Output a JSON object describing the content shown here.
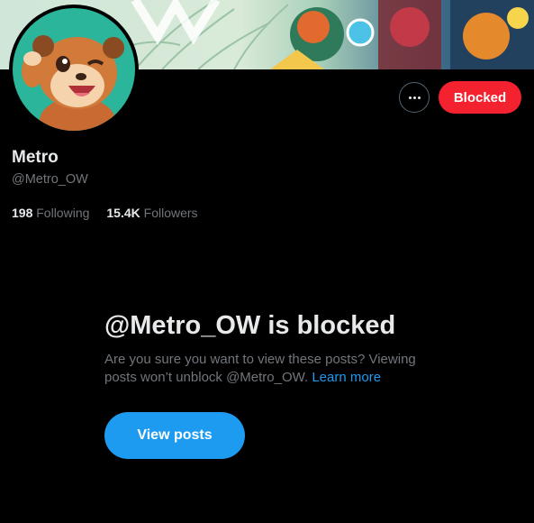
{
  "profile": {
    "display_name": "Metro",
    "handle": "@Metro_OW",
    "following_count": "198",
    "following_label": "Following",
    "followers_count": "15.4K",
    "followers_label": "Followers"
  },
  "actions": {
    "more_icon": "more-horizontal-icon",
    "blocked_label": "Blocked"
  },
  "blocked_notice": {
    "title": "@Metro_OW is blocked",
    "description": "Are you sure you want to view these posts? Viewing posts won’t unblock @Metro_OW.",
    "learn_more_label": "Learn more",
    "view_posts_label": "View posts"
  },
  "colors": {
    "background": "#000000",
    "primary_text": "#e7e9ea",
    "secondary_text": "#71767b",
    "accent_blue": "#1d9bf0",
    "blocked_red": "#f4212e"
  }
}
